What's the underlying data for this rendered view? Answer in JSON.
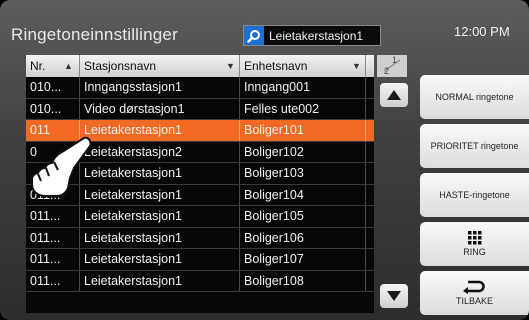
{
  "header": {
    "title": "Ringetoneinnstillinger",
    "search_value": "Leietakerstasjon1",
    "search_icon": "magnifier-icon",
    "time": "12:00 PM"
  },
  "table": {
    "columns": [
      "Nr.",
      "Stasjonsnavn",
      "Enhetsnavn"
    ],
    "rows": [
      {
        "nr": "010...",
        "station": "Inngangsstasjon1",
        "unit": "Inngang001"
      },
      {
        "nr": "010...",
        "station": "Video dørstasjon1",
        "unit": "Felles ute002"
      },
      {
        "nr": "011",
        "station": "Leietakerstasjon1",
        "unit": "Boliger101"
      },
      {
        "nr": "0",
        "station": "Leietakerstasjon2",
        "unit": "Boliger102"
      },
      {
        "nr": "",
        "station": "Leietakerstasjon1",
        "unit": "Boliger103"
      },
      {
        "nr": "011...",
        "station": "Leietakerstasjon1",
        "unit": "Boliger104"
      },
      {
        "nr": "011...",
        "station": "Leietakerstasjon1",
        "unit": "Boliger105"
      },
      {
        "nr": "011...",
        "station": "Leietakerstasjon1",
        "unit": "Boliger106"
      },
      {
        "nr": "011...",
        "station": "Leietakerstasjon1",
        "unit": "Boliger107"
      },
      {
        "nr": "011...",
        "station": "Leietakerstasjon1",
        "unit": "Boliger108"
      }
    ],
    "selected_row": 2,
    "page_current": "1",
    "page_total": "2"
  },
  "side_buttons": {
    "normal": "NORMAL ringetone",
    "priority": "PRIORITET ringetone",
    "urgent": "HASTE-ringetone",
    "ring": "RING",
    "back": "TILBAKE"
  },
  "colors": {
    "selected_row": "#f06a23",
    "search_icon_bg": "#1d6fd6"
  }
}
